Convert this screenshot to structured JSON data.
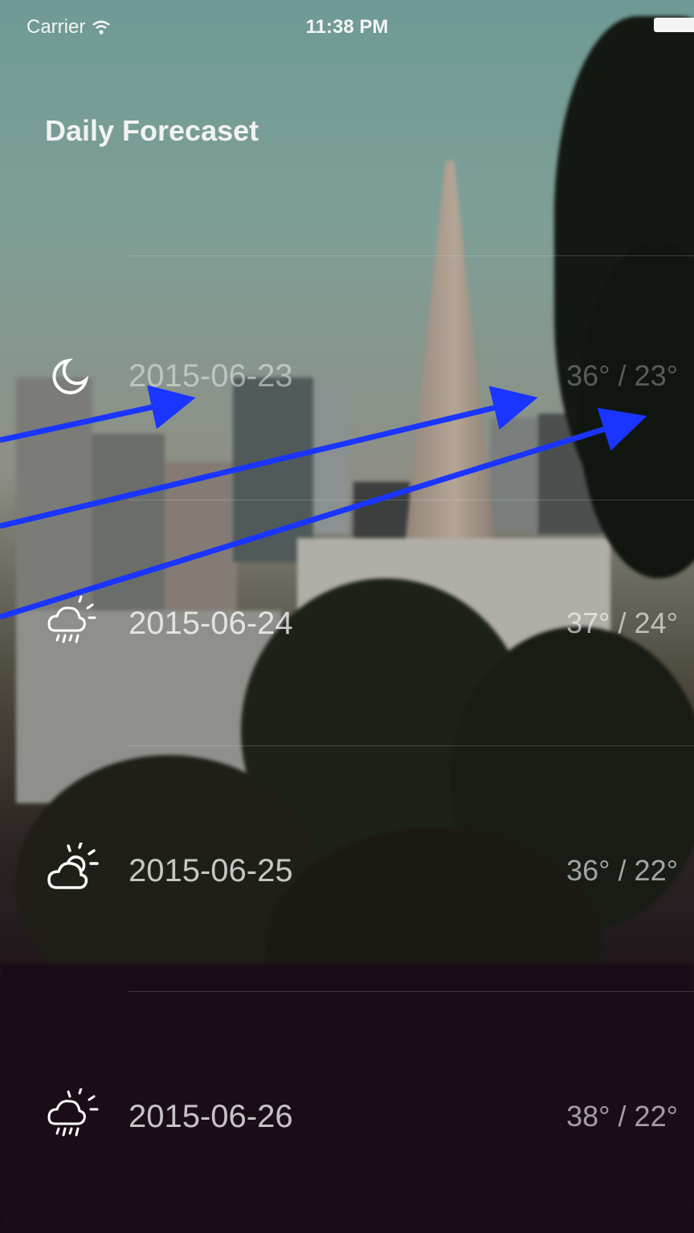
{
  "status_bar": {
    "carrier": "Carrier",
    "time": "11:38 PM"
  },
  "header": {
    "title": "Daily Forecaset"
  },
  "forecast": [
    {
      "icon": "moon-icon",
      "date": "2015-06-23",
      "temp": "36° / 23°"
    },
    {
      "icon": "cloud-rain-sun-icon",
      "date": "2015-06-24",
      "temp": "37° / 24°"
    },
    {
      "icon": "cloud-sun-icon",
      "date": "2015-06-25",
      "temp": "36° / 22°"
    },
    {
      "icon": "cloud-rain-sun-icon",
      "date": "2015-06-26",
      "temp": "38° / 22°"
    }
  ],
  "colors": {
    "text": "#ffffff",
    "annotation_arrow": "#1a35ff"
  }
}
